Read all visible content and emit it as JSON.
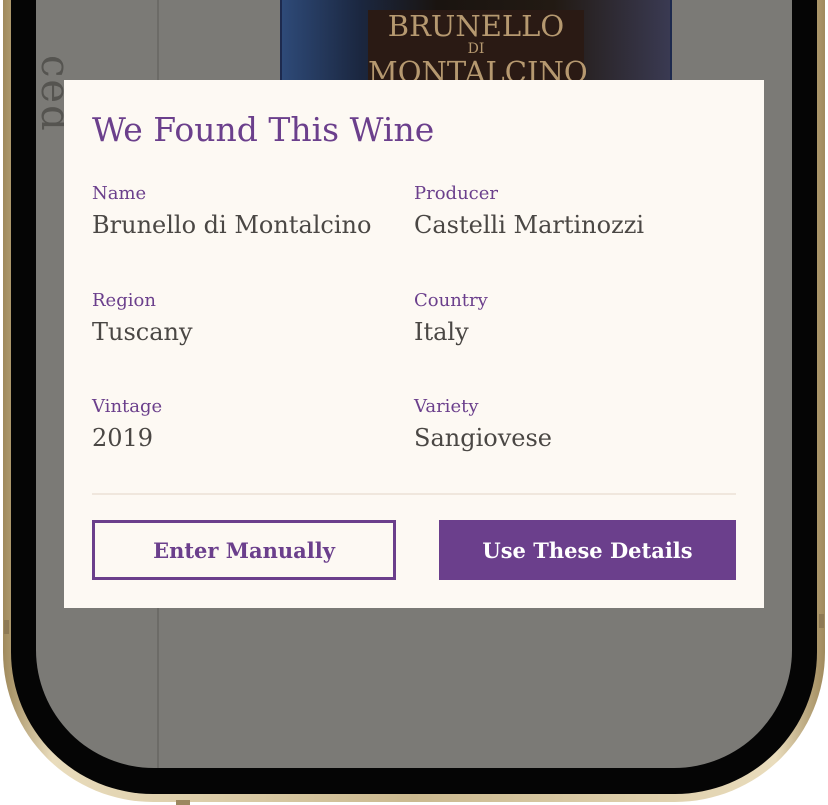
{
  "background": {
    "vertical_text": "ced",
    "bottle_label_line1": "BRUNELLO",
    "bottle_label_line2": "DI",
    "bottle_label_line3": "MONTALCINO"
  },
  "modal": {
    "title": "We Found This Wine",
    "fields": [
      {
        "label": "Name",
        "value": "Brunello di Montalcino"
      },
      {
        "label": "Producer",
        "value": "Castelli Martinozzi"
      },
      {
        "label": "Region",
        "value": "Tuscany"
      },
      {
        "label": "Country",
        "value": "Italy"
      },
      {
        "label": "Vintage",
        "value": "2019"
      },
      {
        "label": "Variety",
        "value": "Sangiovese"
      }
    ],
    "secondary_button": "Enter Manually",
    "primary_button": "Use These Details"
  },
  "colors": {
    "accent": "#6b3f8c",
    "modal_bg": "#fdf9f3",
    "overlay": "#7b7a76",
    "value_text": "#4a4744"
  }
}
